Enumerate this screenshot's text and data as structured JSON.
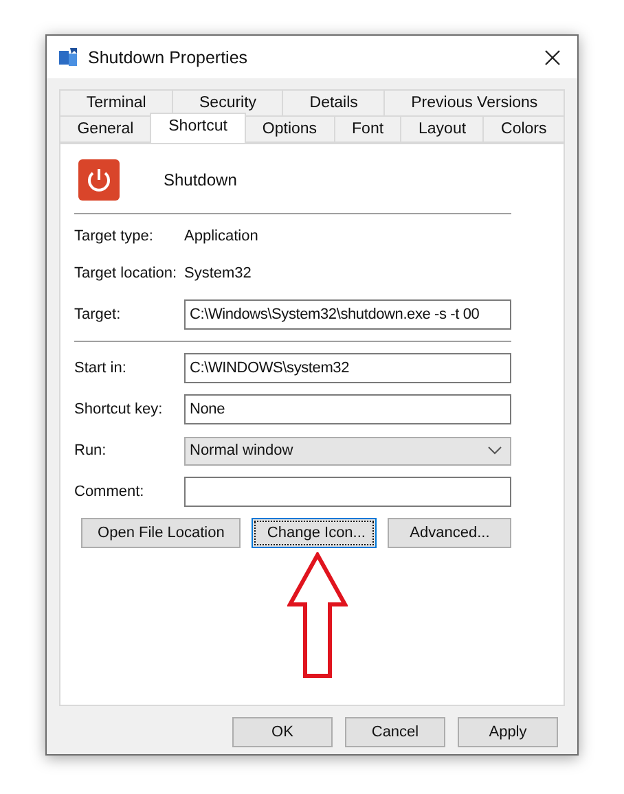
{
  "window": {
    "title": "Shutdown Properties"
  },
  "tab_rows": [
    [
      {
        "label": "Terminal",
        "selected": false
      },
      {
        "label": "Security",
        "selected": false
      },
      {
        "label": "Details",
        "selected": false
      },
      {
        "label": "Previous Versions",
        "selected": false
      }
    ],
    [
      {
        "label": "General",
        "selected": false
      },
      {
        "label": "Shortcut",
        "selected": true
      },
      {
        "label": "Options",
        "selected": false
      },
      {
        "label": "Font",
        "selected": false
      },
      {
        "label": "Layout",
        "selected": false
      },
      {
        "label": "Colors",
        "selected": false
      }
    ]
  ],
  "shortcut_name": "Shutdown",
  "info": [
    {
      "label": "Target type:",
      "value": "Application"
    },
    {
      "label": "Target location:",
      "value": "System32"
    }
  ],
  "target": {
    "label": "Target:",
    "value": "C:\\Windows\\System32\\shutdown.exe -s -t 00"
  },
  "fields": [
    {
      "kind": "text",
      "label": "Start in:",
      "value": "C:\\WINDOWS\\system32"
    },
    {
      "kind": "text",
      "label": "Shortcut key:",
      "value": "None"
    },
    {
      "kind": "dropdown",
      "label": "Run:",
      "value": "Normal window"
    },
    {
      "kind": "text",
      "label": "Comment:"
    }
  ],
  "actions": [
    {
      "label": "Open File Location",
      "focused": false
    },
    {
      "label": "Change Icon...",
      "focused": true
    },
    {
      "label": "Advanced...",
      "focused": false
    }
  ],
  "buttons": [
    "OK",
    "Cancel",
    "Apply"
  ]
}
